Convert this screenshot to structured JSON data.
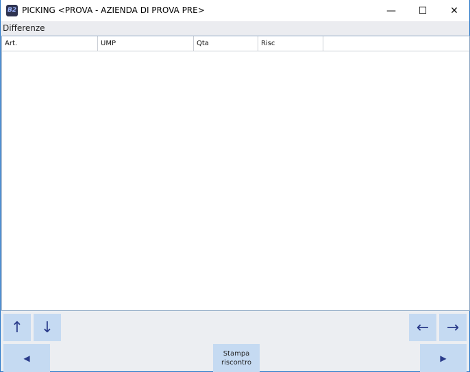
{
  "window": {
    "title": "PICKING <PROVA - AZIENDA DI PROVA PRE>",
    "icon": "B2",
    "minimize": "—",
    "maximize": "☐",
    "close": "✕"
  },
  "section": {
    "label": "Differenze"
  },
  "grid": {
    "columns": [
      "Art.",
      "UMP",
      "Qta",
      "Risc",
      ""
    ],
    "rows": []
  },
  "buttons": {
    "up": "↑",
    "down": "↓",
    "left": "←",
    "right": "→",
    "prev": "◀",
    "next": "▶",
    "stampa_line1": "Stampa",
    "stampa_line2": "riscontro"
  }
}
